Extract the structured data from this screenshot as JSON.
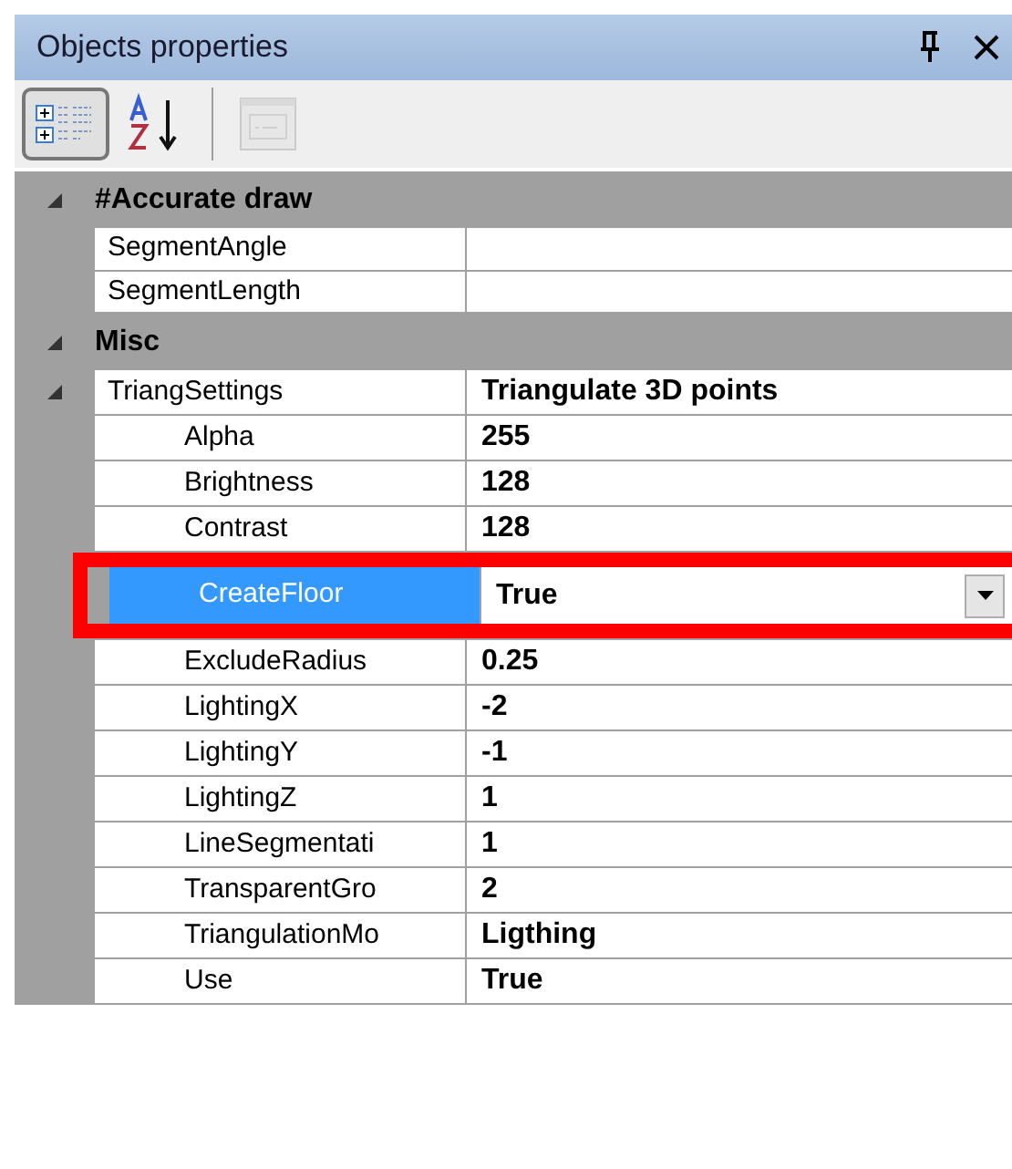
{
  "panel": {
    "title": "Objects properties"
  },
  "toolbar": [
    {
      "kind": "categorized",
      "selected": true,
      "disabled": false
    },
    {
      "kind": "alphabetical",
      "selected": false,
      "disabled": false
    },
    {
      "kind": "property-pages",
      "selected": false,
      "disabled": true
    }
  ],
  "categories": [
    {
      "name": "#Accurate draw",
      "expanded": true,
      "properties": [
        {
          "name": "SegmentAngle",
          "selected": false
        },
        {
          "name": "SegmentLength",
          "selected": false
        }
      ]
    },
    {
      "name": "Misc",
      "expanded": true,
      "properties": [
        {
          "name": "TriangSettings",
          "value": "Triangulate 3D points",
          "selected": false,
          "expanded": true,
          "children": [
            {
              "name": "Alpha",
              "value": "255",
              "selected": false
            },
            {
              "name": "Brightness",
              "value": "128",
              "selected": false
            },
            {
              "name": "Contrast",
              "value": "128",
              "selected": false
            },
            {
              "name": "CreateFloor",
              "value": "True",
              "selected": true,
              "highlighted": true
            },
            {
              "name": "ExcludeRadius",
              "value": "0.25",
              "selected": false
            },
            {
              "name": "LightingX",
              "value": "-2",
              "selected": false
            },
            {
              "name": "LightingY",
              "value": "-1",
              "selected": false
            },
            {
              "name": "LightingZ",
              "value": "1",
              "selected": false
            },
            {
              "name": "LineSegmentati",
              "value": "1",
              "selected": false
            },
            {
              "name": "TransparentGro",
              "value": "2",
              "selected": false
            },
            {
              "name": "TriangulationMo",
              "value": "Ligthing",
              "selected": false
            },
            {
              "name": "Use",
              "value": "True",
              "selected": false
            }
          ]
        }
      ]
    }
  ]
}
